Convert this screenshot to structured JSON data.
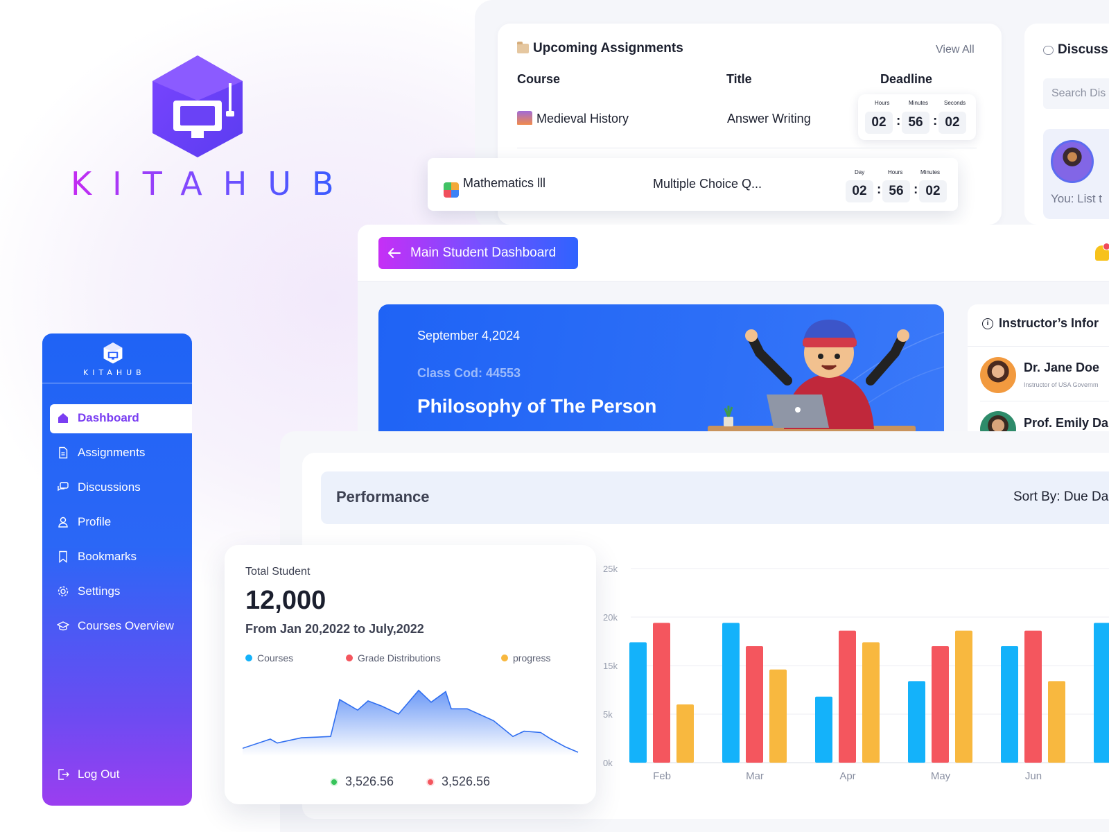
{
  "brand": {
    "name": "KITAHUB",
    "accent_start": "#c42bf2",
    "accent_end": "#2f63ff"
  },
  "assignments": {
    "title": "Upcoming Assignments",
    "view_all": "View All",
    "columns": {
      "course": "Course",
      "title": "Title",
      "deadline": "Deadline"
    },
    "rows": [
      {
        "course": "Medieval History",
        "title": "Answer Writing",
        "countdown_labels": [
          "Hours",
          "Minutes",
          "Seconds"
        ],
        "countdown_values": [
          "02",
          "56",
          "02"
        ]
      },
      {
        "course": "Mathematics lll",
        "title": "Multiple Choice Q...",
        "countdown_labels": [
          "Day",
          "Hours",
          "Minutes"
        ],
        "countdown_values": [
          "02",
          "56",
          "02"
        ]
      }
    ]
  },
  "discussions": {
    "title": "Discuss",
    "search_placeholder": "Search Dis",
    "last_message": "You: List t"
  },
  "header": {
    "back_label": "Main Student Dashboard",
    "notification_count": "1"
  },
  "hero": {
    "date": "September 4,2024",
    "class_code": "Class Cod: 44553",
    "course_name": "Philosophy of The Person"
  },
  "instructors": {
    "title": "Instructor’s Infor",
    "items": [
      {
        "name": "Dr. Jane Doe",
        "role": "Instructor of USA Governm"
      },
      {
        "name": "Prof. Emily Da",
        "role": ""
      }
    ]
  },
  "performance": {
    "title": "Performance",
    "sort_label": "Sort By: Due Da"
  },
  "total_student": {
    "label": "Total Student",
    "value": "12,000",
    "range": "From Jan 20,2022 to July,2022",
    "legend": [
      {
        "name": "Courses",
        "color": "#14b2fa"
      },
      {
        "name": "Grade Distributions",
        "color": "#f4565e"
      },
      {
        "name": "progress",
        "color": "#f8b83f"
      }
    ],
    "area_values": [
      3,
      10,
      7,
      11,
      11.5,
      12,
      40,
      32,
      39,
      35,
      29,
      47,
      38,
      46,
      33,
      33,
      24,
      12,
      16,
      15,
      10,
      4,
      0
    ],
    "stats": [
      {
        "value": "3,526.56",
        "color": "#36c35a"
      },
      {
        "value": "3,526.56",
        "color": "#f4565e"
      }
    ]
  },
  "chart_data": {
    "type": "bar",
    "categories": [
      "Feb",
      "Mar",
      "Apr",
      "May",
      "Jun",
      ""
    ],
    "series": [
      {
        "name": "Courses",
        "color": "#14b2fa",
        "values": [
          15500,
          18000,
          8500,
          10500,
          15000,
          18000
        ]
      },
      {
        "name": "Grade Distributions",
        "color": "#f4565e",
        "values": [
          18000,
          15000,
          17000,
          15000,
          17000,
          null
        ]
      },
      {
        "name": "progress",
        "color": "#f8b83f",
        "values": [
          7500,
          12000,
          15500,
          17000,
          10500,
          null
        ]
      }
    ],
    "yticks": [
      "0k",
      "5k",
      "15k",
      "20k",
      "25k"
    ],
    "ylim": [
      0,
      25000
    ],
    "grid": true
  },
  "sidebar": {
    "brand": "KITAHUB",
    "items": [
      {
        "label": "Dashboard",
        "icon": "home-icon"
      },
      {
        "label": "Assignments",
        "icon": "document-icon"
      },
      {
        "label": "Discussions",
        "icon": "chat-icon"
      },
      {
        "label": "Profile",
        "icon": "user-icon"
      },
      {
        "label": "Bookmarks",
        "icon": "bookmark-icon"
      },
      {
        "label": "Settings",
        "icon": "gear-icon"
      },
      {
        "label": "Courses Overview",
        "icon": "graduation-cap-icon"
      }
    ],
    "logout": "Log Out"
  }
}
